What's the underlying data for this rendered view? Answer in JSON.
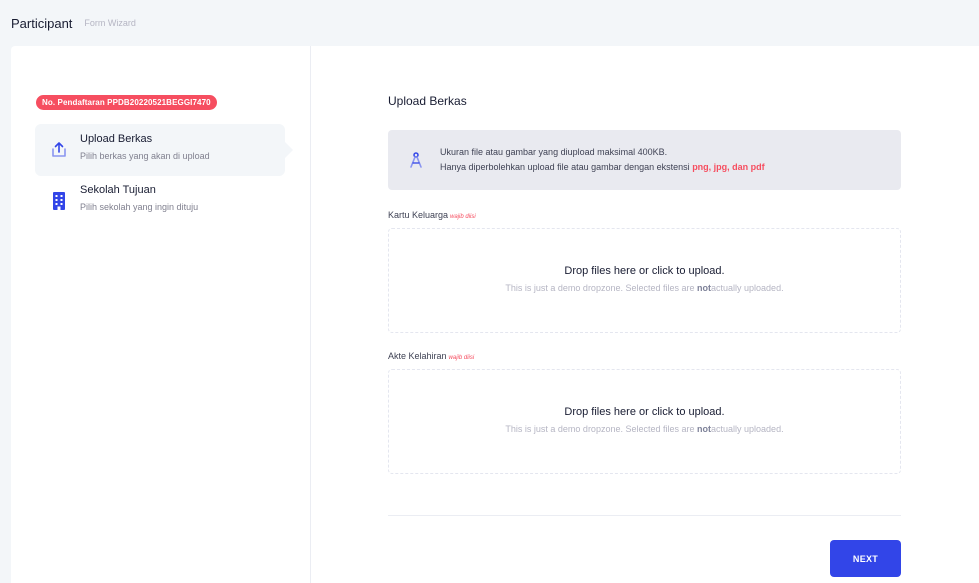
{
  "subheader": {
    "title": "Participant",
    "subtitle": "Form Wizard"
  },
  "registration_badge": "No. Pendaftaran PPDB20220521BEGGI7470",
  "wizard_nav": [
    {
      "title": "Upload Berkas",
      "description": "Pilih berkas yang akan di upload",
      "icon": "upload-icon",
      "active": true
    },
    {
      "title": "Sekolah Tujuan",
      "description": "Pilih sekolah yang ingin dituju",
      "icon": "building-icon",
      "active": false
    }
  ],
  "main": {
    "heading": "Upload Berkas",
    "alert": {
      "line1": "Ukuran file atau gambar yang diupload maksimal 400KB.",
      "line2_prefix": "Hanya diperbolehkan upload file atau gambar dengan ekstensi ",
      "line2_highlight": "png, jpg, dan pdf",
      "icon": "compass-icon"
    },
    "fields": [
      {
        "label": "Kartu Keluarga",
        "required_text": "wajib diisi",
        "dropzone_title": "Drop files here or click to upload.",
        "dropzone_desc_before": "This is just a demo dropzone. Selected files are ",
        "dropzone_desc_bold": "not",
        "dropzone_desc_after": "actually uploaded."
      },
      {
        "label": "Akte Kelahiran",
        "required_text": "wajib diisi",
        "dropzone_title": "Drop files here or click to upload.",
        "dropzone_desc_before": "This is just a demo dropzone. Selected files are ",
        "dropzone_desc_bold": "not",
        "dropzone_desc_after": "actually uploaded."
      }
    ],
    "next_button": "NEXT"
  },
  "colors": {
    "accent": "#3245e8",
    "danger": "#f64e60",
    "page_bg": "#f3f6f9"
  }
}
